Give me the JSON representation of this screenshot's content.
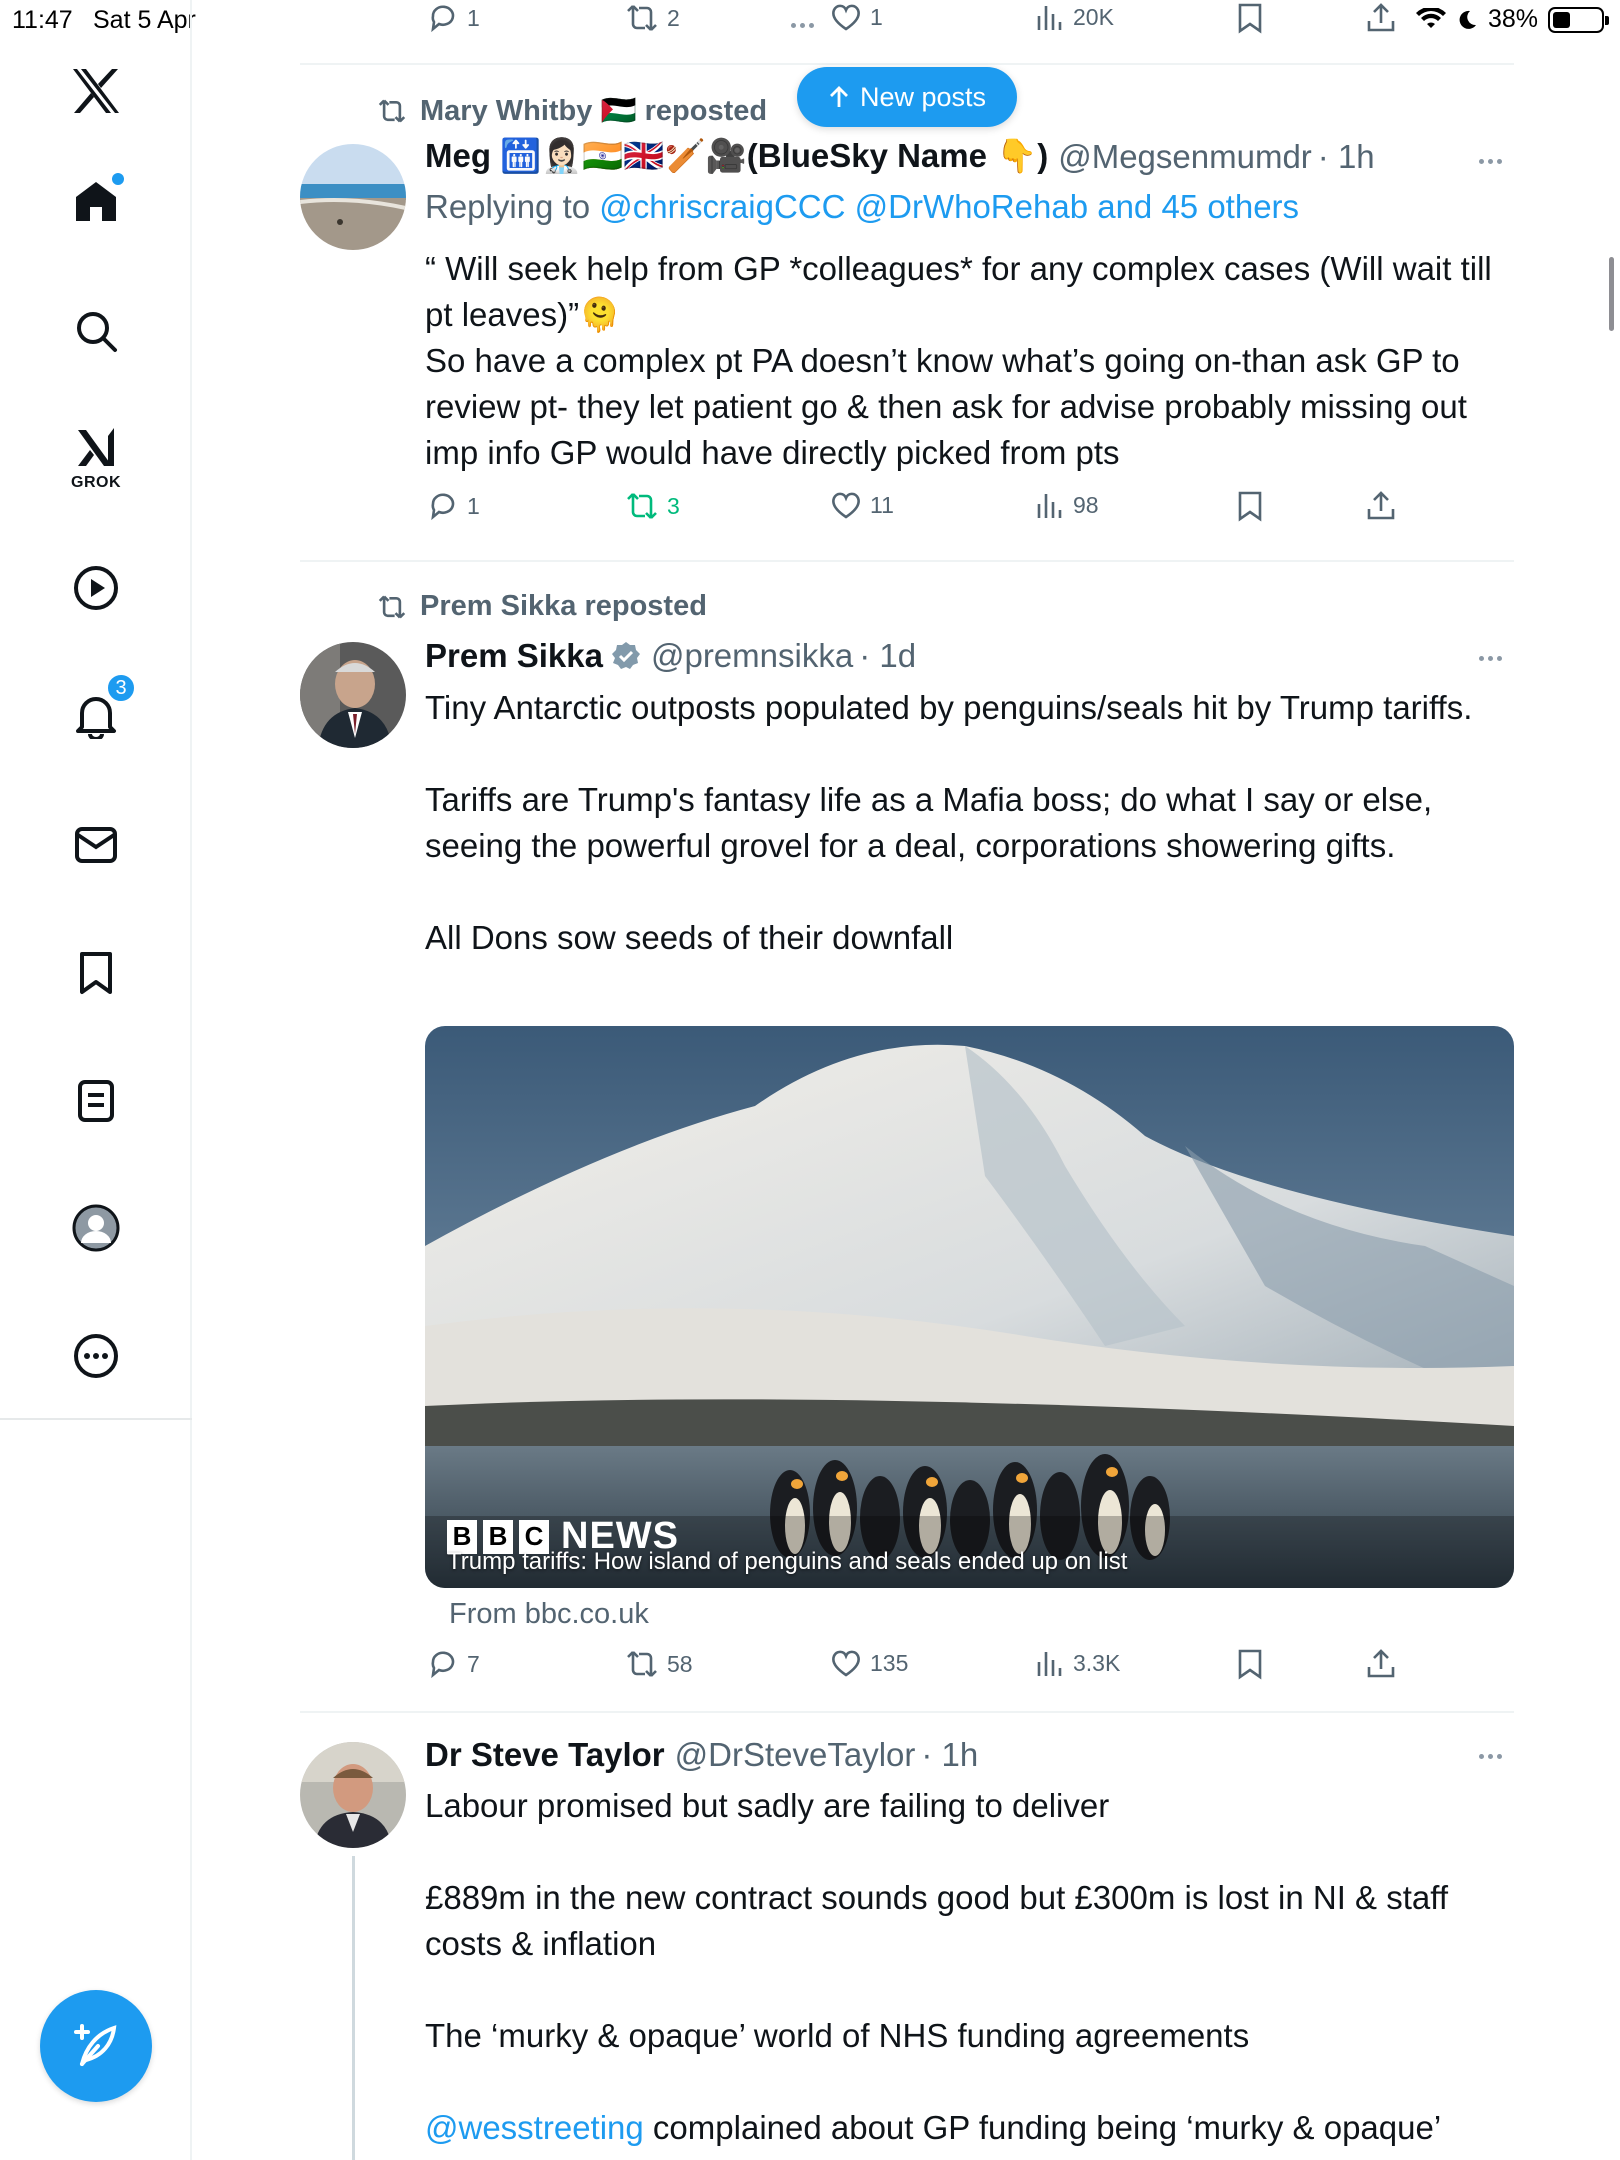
{
  "status_bar": {
    "time": "11:47",
    "date": "Sat 5 Apr",
    "battery": "38%",
    "battery_level": 0.38
  },
  "sidebar": {
    "logo": "x-logo-icon",
    "items": [
      {
        "name": "home",
        "icon": "home-icon"
      },
      {
        "name": "search",
        "icon": "search-icon"
      },
      {
        "name": "grok",
        "icon": "grok-icon",
        "label": "GROK"
      },
      {
        "name": "video",
        "icon": "play-icon"
      },
      {
        "name": "notifications",
        "icon": "bell-icon",
        "badge": "3"
      },
      {
        "name": "messages",
        "icon": "mail-icon"
      },
      {
        "name": "bookmarks",
        "icon": "bookmark-icon"
      },
      {
        "name": "lists",
        "icon": "list-icon"
      },
      {
        "name": "profile",
        "icon": "profile-icon"
      },
      {
        "name": "more",
        "icon": "more-icon"
      }
    ],
    "compose": "compose-icon"
  },
  "new_posts": {
    "label": "New posts"
  },
  "top_actions": {
    "replies": "1",
    "reposts": "2",
    "likes": "1",
    "views": "20K"
  },
  "posts": [
    {
      "reposted_by": "Mary Whitby 🇵🇸 reposted",
      "author": "Meg 🛗👩🏻‍⚕️🇮🇳🇬🇧🏏🎥(BlueSky Name 👇)",
      "handle": "@Megsenmumdr",
      "time": "· 1h",
      "replying_prefix": "Replying to ",
      "replying_links": "@chriscraigCCC @DrWhoRehab and 45 others",
      "body": [
        "“ Will seek help from GP *colleagues* for any complex cases (Will wait till pt leaves)”🫠",
        "So have a complex pt PA doesn’t know what’s going on-than ask GP to review pt- they let patient go & then ask for advise probably missing out imp info GP would have directly picked from pts"
      ],
      "actions": {
        "replies": "1",
        "reposts": "3",
        "likes": "11",
        "views": "98"
      }
    },
    {
      "reposted_by": "Prem Sikka reposted",
      "author": "Prem Sikka",
      "verified": true,
      "handle": "@premnsikka",
      "time": "· 1d",
      "body": [
        "Tiny Antarctic outposts populated by penguins/seals hit by Trump tariffs.",
        "",
        "Tariffs are Trump's fantasy life as a Mafia boss; do what I say or else, seeing the powerful grovel for a deal, corporations showering gifts.",
        "",
        "All Dons sow seeds of their downfall"
      ],
      "card": {
        "title": "Trump tariffs: How island of penguins and seals ended up on list",
        "logo_letters": [
          "B",
          "B",
          "C"
        ],
        "logo_word": "NEWS",
        "from": "From bbc.co.uk"
      },
      "actions": {
        "replies": "7",
        "reposts": "58",
        "likes": "135",
        "views": "3.3K"
      }
    },
    {
      "author": "Dr Steve Taylor",
      "handle": "@DrSteveTaylor",
      "time": "· 1h",
      "body": [
        "Labour promised but sadly are failing to deliver",
        "",
        "£889m in the new contract sounds good but £300m is lost in NI & staff costs & inflation",
        "",
        "The ‘murky & opaque’ world of NHS funding agreements",
        ""
      ],
      "last_line_link": "@wesstreeting",
      "last_line_text": " complained about GP funding being ‘murky & opaque’"
    }
  ]
}
